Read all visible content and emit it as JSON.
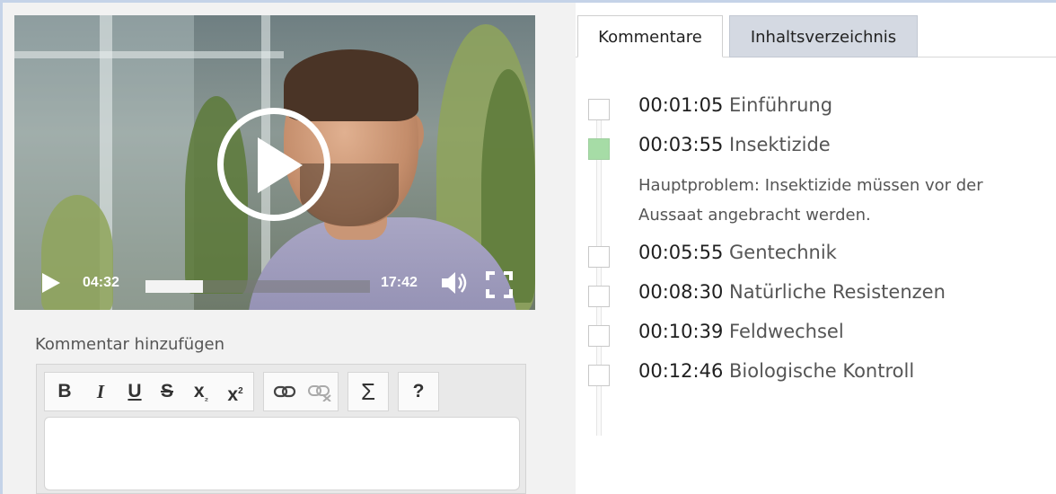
{
  "player": {
    "current_time": "04:32",
    "total_time": "17:42",
    "progress": 0.256,
    "icons": [
      "play-icon",
      "volume-icon",
      "fullscreen-icon"
    ]
  },
  "comment_form": {
    "label": "Kommentar hinzufügen",
    "toolbar": {
      "bold": "B",
      "italic": "I",
      "underline": "U",
      "strike": "S",
      "subscript": "x",
      "superscript": "x",
      "sum": "Σ",
      "help": "?"
    }
  },
  "tabs": [
    {
      "label": "Kommentare"
    },
    {
      "label": "Inhaltsverzeichnis"
    }
  ],
  "toc": [
    {
      "time": "00:01:05",
      "title": "Einführung"
    },
    {
      "time": "00:03:55",
      "title": "Insektizide",
      "description": "Hauptproblem: Insektizide müssen vor der Aussaat angebracht werden.",
      "active": true
    },
    {
      "time": "00:05:55",
      "title": "Gentechnik"
    },
    {
      "time": "00:08:30",
      "title": "Natürliche Resistenzen"
    },
    {
      "time": "00:10:39",
      "title": "Feldwechsel"
    },
    {
      "time": "00:12:46",
      "title": "Biologische Kontroll"
    }
  ],
  "colors": {
    "active_marker": "#a6dca6",
    "active_tab_bg": "#d4d9e2",
    "frame": "#c5d3e8"
  }
}
